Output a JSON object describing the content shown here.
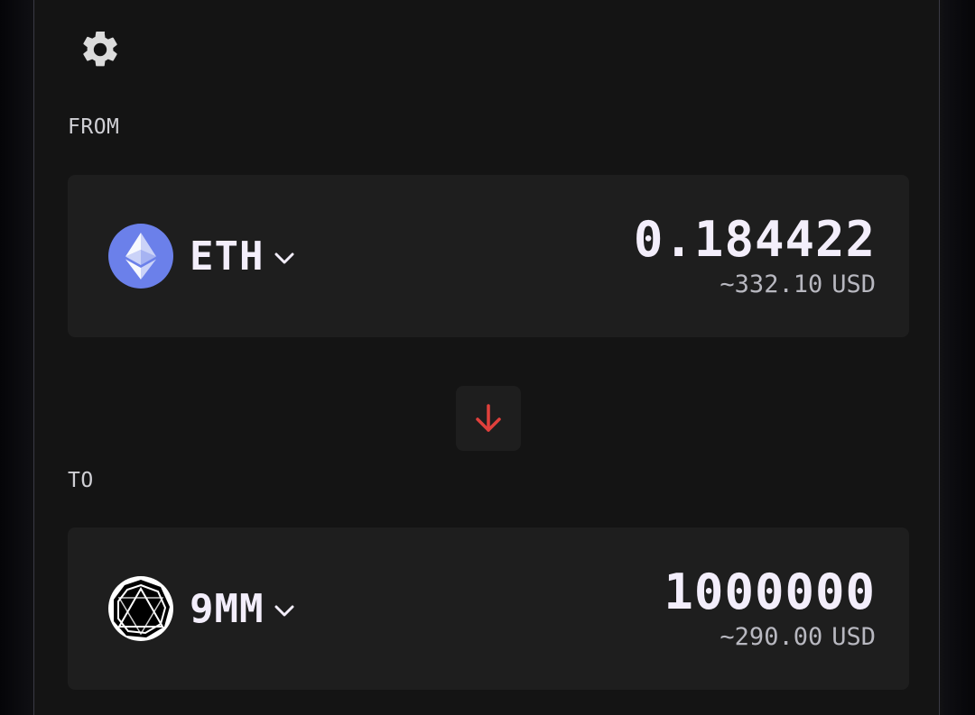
{
  "settings": {
    "icon": "gear-icon"
  },
  "swap": {
    "from": {
      "section_label": "FROM",
      "token_symbol": "ETH",
      "token_icon": "ethereum-logo",
      "amount": "0.184422",
      "usd_value": "~332.10",
      "usd_unit": "USD"
    },
    "switch_icon": "arrow-down-icon",
    "to": {
      "section_label": "TO",
      "token_symbol": "9MM",
      "token_icon": "9mm-logo",
      "amount": "1000000",
      "usd_value": "~290.00",
      "usd_unit": "USD"
    }
  },
  "colors": {
    "background": "#141414",
    "card": "#1e1e1e",
    "accent_red": "#e0403c",
    "eth_blue": "#6b80ea",
    "text_primary": "#f3eefb",
    "text_secondary": "#b8b8c0"
  }
}
